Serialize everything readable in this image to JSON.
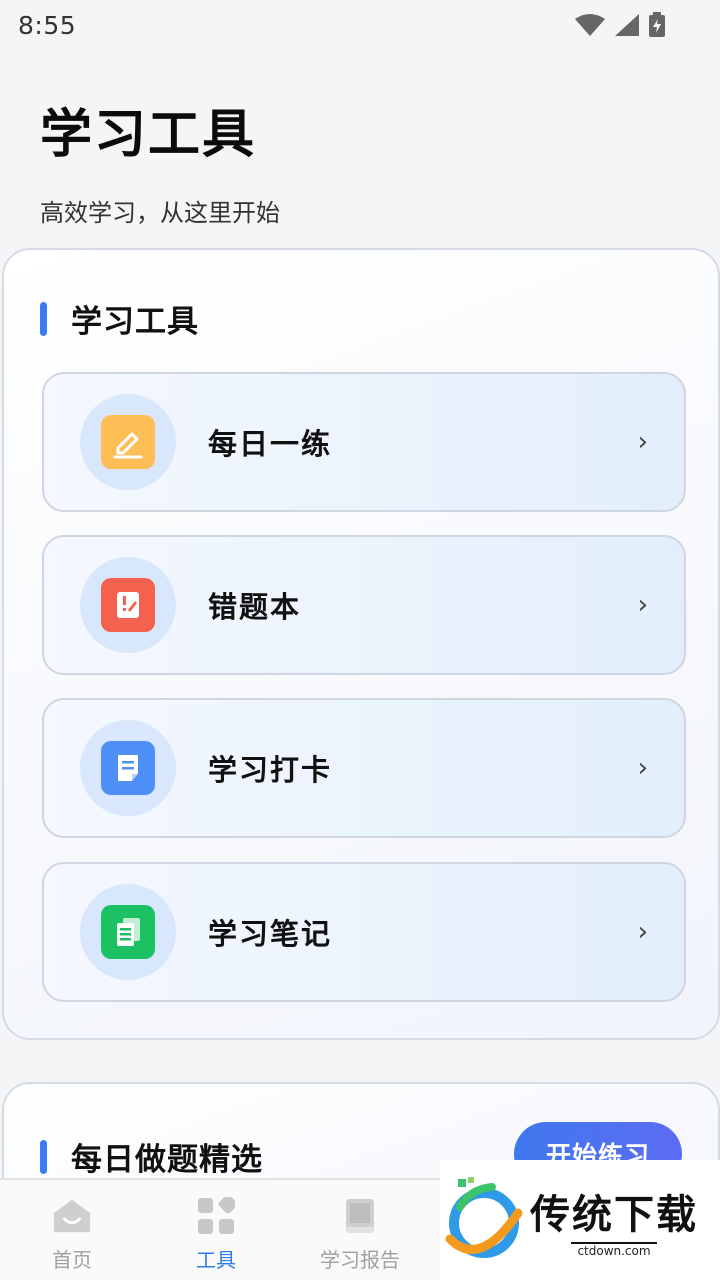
{
  "status_bar": {
    "time": "8:55",
    "icons": [
      "wifi-icon",
      "signal-icon",
      "battery-charging-icon"
    ]
  },
  "header": {
    "title": "学习工具",
    "subtitle": "高效学习，从这里开始"
  },
  "tools_section": {
    "title": "学习工具",
    "items": [
      {
        "label": "每日一练",
        "icon": "pencil-icon",
        "icon_color": "#ffbe55"
      },
      {
        "label": "错题本",
        "icon": "error-book-icon",
        "icon_color": "#f4624f"
      },
      {
        "label": "学习打卡",
        "icon": "checkin-note-icon",
        "icon_color": "#4d8ff5"
      },
      {
        "label": "学习笔记",
        "icon": "notes-icon",
        "icon_color": "#1cc164"
      }
    ],
    "chevron": "›"
  },
  "daily_picks": {
    "title": "每日做题精选",
    "button_label": "开始练习"
  },
  "tab_bar": {
    "tabs": [
      {
        "label": "首页",
        "icon": "home-icon"
      },
      {
        "label": "工具",
        "icon": "grid-icon",
        "active": true
      },
      {
        "label": "学习报告",
        "icon": "book-icon"
      }
    ]
  },
  "watermark": {
    "brand": "传统下载",
    "domain": "ctdown.com"
  },
  "colors": {
    "accent": "#2f7be8",
    "section_bar": "#3b7cf5"
  }
}
